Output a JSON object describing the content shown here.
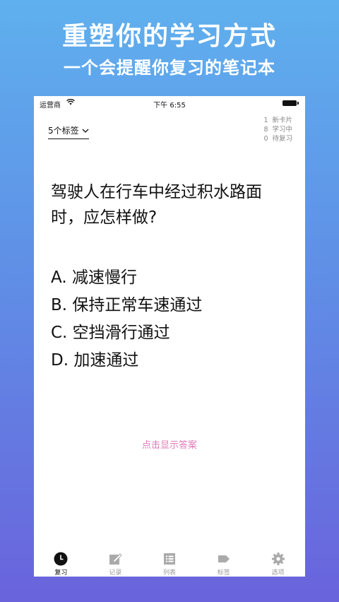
{
  "promo": {
    "title": "重塑你的学习方式",
    "subtitle": "一个会提醒你复习的笔记本"
  },
  "status_bar": {
    "carrier": "运营商",
    "time": "下午 6:55"
  },
  "tag_selector": {
    "label": "5个标签"
  },
  "stats": [
    {
      "count": "1",
      "label": "新卡片"
    },
    {
      "count": "8",
      "label": "学习中"
    },
    {
      "count": "0",
      "label": "待复习"
    }
  ],
  "card": {
    "question": "驾驶人在行车中经过积水路面时，应怎样做?",
    "options": [
      "A. 减速慢行",
      "B. 保持正常车速通过",
      "C. 空挡滑行通过",
      "D. 加速通过"
    ],
    "reveal_label": "点击显示答案"
  },
  "tabs": [
    {
      "label": "复习",
      "icon": "clock-icon",
      "active": true
    },
    {
      "label": "记录",
      "icon": "edit-icon",
      "active": false
    },
    {
      "label": "列表",
      "icon": "list-icon",
      "active": false
    },
    {
      "label": "标签",
      "icon": "tag-icon",
      "active": false
    },
    {
      "label": "选项",
      "icon": "gear-icon",
      "active": false
    }
  ],
  "colors": {
    "accent": "#e07ab8",
    "gradient_top": "#5fb0ee",
    "gradient_bottom": "#6a63dc"
  }
}
